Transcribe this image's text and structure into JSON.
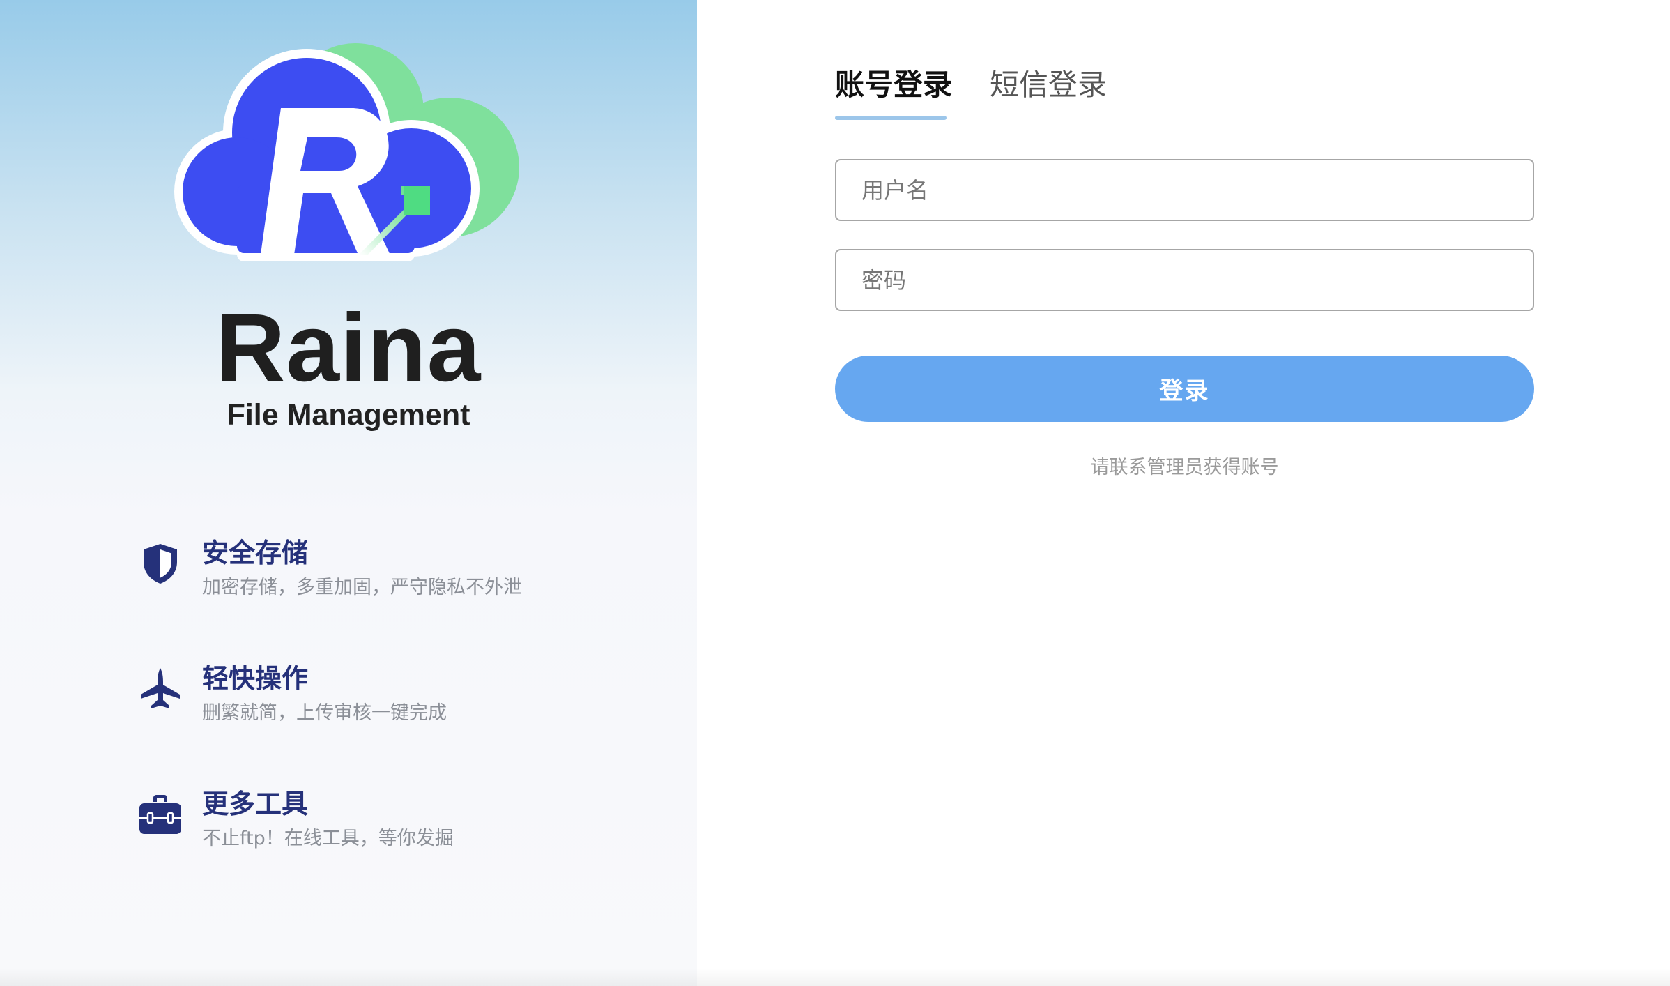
{
  "brand": {
    "name": "Raina",
    "subtitle": "File Management",
    "logo_icon": "cloud-r-upload-logo",
    "colors": {
      "cloud_blue": "#3d4df2",
      "cloud_green": "#7fe09c",
      "text_dark": "#1f1f1f"
    }
  },
  "features": [
    {
      "icon": "shield-icon",
      "title": "安全存储",
      "desc": "加密存储，多重加固，严守隐私不外泄"
    },
    {
      "icon": "jet-icon",
      "title": "轻快操作",
      "desc": "删繁就简，上传审核一键完成"
    },
    {
      "icon": "toolbox-icon",
      "title": "更多工具",
      "desc": "不止ftp！在线工具，等你发掘"
    }
  ],
  "login": {
    "tabs": [
      {
        "label": "账号登录",
        "active": true
      },
      {
        "label": "短信登录",
        "active": false
      }
    ],
    "username_placeholder": "用户名",
    "password_placeholder": "密码",
    "submit_label": "登录",
    "hint": "请联系管理员获得账号",
    "colors": {
      "button": "#66a7f0",
      "tab_underline": "#9cc6ea",
      "feature_title": "#25317a"
    }
  }
}
